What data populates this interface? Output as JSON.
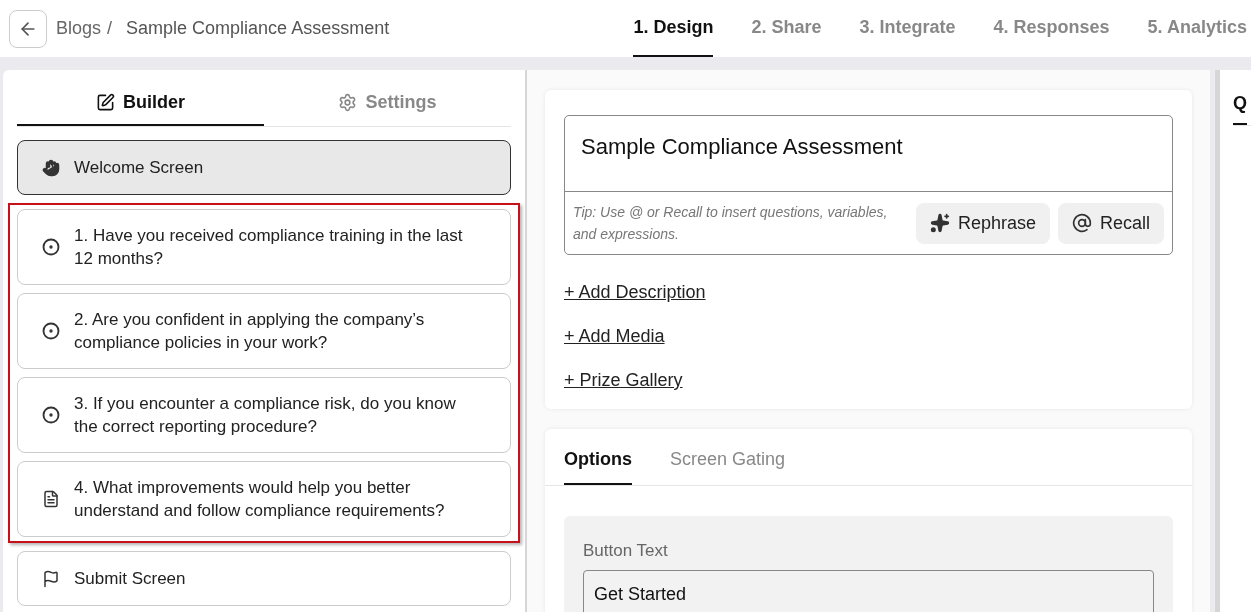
{
  "breadcrumb": {
    "parent": "Blogs",
    "separator": "/",
    "current": "Sample Compliance Assessment"
  },
  "steps": [
    {
      "label": "1. Design",
      "selected": true
    },
    {
      "label": "2. Share",
      "selected": false
    },
    {
      "label": "3. Integrate",
      "selected": false
    },
    {
      "label": "4. Responses",
      "selected": false
    },
    {
      "label": "5. Analytics",
      "selected": false
    }
  ],
  "sidebar": {
    "tabs": [
      {
        "label": "Builder",
        "kind": "builder",
        "selected": true
      },
      {
        "label": "Settings",
        "kind": "settings",
        "selected": false
      }
    ],
    "screens": [
      {
        "label": "Welcome Screen",
        "kind": "welcome",
        "selected": true,
        "highlighted": false
      },
      {
        "label": "1. Have you received compliance training in the last 12 months?",
        "kind": "radio",
        "selected": false,
        "highlighted": true
      },
      {
        "label": "2. Are you confident in applying the company’s compliance policies in your work?",
        "kind": "radio",
        "selected": false,
        "highlighted": true
      },
      {
        "label": "3. If you encounter a compliance risk, do you know the correct reporting procedure?",
        "kind": "radio",
        "selected": false,
        "highlighted": true
      },
      {
        "label": "4. What improvements would help you better understand and follow compliance requirements?",
        "kind": "text",
        "selected": false,
        "highlighted": true
      },
      {
        "label": "Submit Screen",
        "kind": "submit",
        "selected": false,
        "highlighted": false
      }
    ]
  },
  "editor": {
    "title": "Sample Compliance Assessment",
    "tip": "Tip: Use @ or Recall to insert questions, variables, and expressions.",
    "buttons": [
      {
        "label": "Rephrase",
        "kind": "rephrase"
      },
      {
        "label": "Recall",
        "kind": "recall"
      }
    ],
    "links": [
      "+ Add Description",
      "+ Add Media",
      "+ Prize Gallery"
    ]
  },
  "options": {
    "tabs": [
      {
        "label": "Options",
        "selected": true
      },
      {
        "label": "Screen Gating",
        "selected": false
      }
    ],
    "button_text": {
      "label": "Button Text",
      "value": "Get Started"
    }
  },
  "right_panel": {
    "tab": {
      "label": "Q",
      "selected": true
    }
  }
}
